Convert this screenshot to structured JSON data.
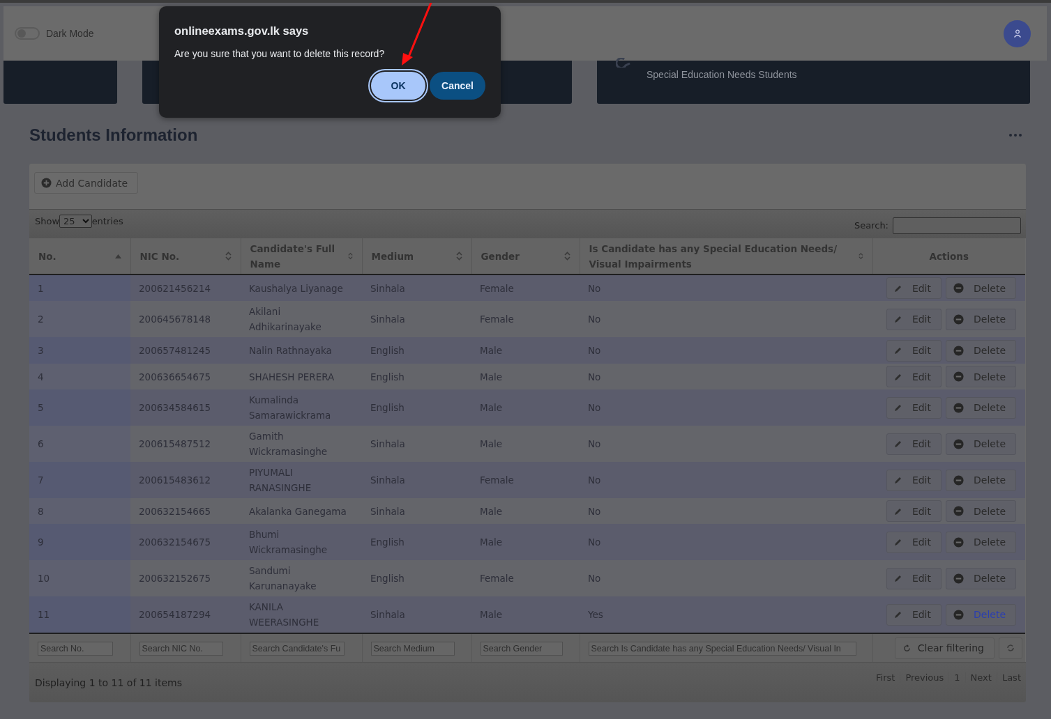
{
  "header": {
    "dark_mode": {
      "label": "Dark Mode",
      "on": false
    }
  },
  "stat_cards": [
    {
      "kind": "blank"
    },
    {
      "kind": "blank"
    },
    {
      "kind": "labeled",
      "label": "Special Education Needs Students"
    }
  ],
  "page_title": "Students Information",
  "add_button": {
    "label": "Add Candidate"
  },
  "length_menu": {
    "show": "Show",
    "value": "25",
    "entries": "entries"
  },
  "search": {
    "label": "Search:"
  },
  "table": {
    "columns": [
      {
        "label": "No.",
        "sortable": true,
        "sorted": true
      },
      {
        "label": "NIC No.",
        "sortable": true,
        "sorted": false
      },
      {
        "label": "Candidate's Full Name",
        "sortable": true,
        "sorted": false
      },
      {
        "label": "Medium",
        "sortable": true,
        "sorted": false
      },
      {
        "label": "Gender",
        "sortable": true,
        "sorted": false
      },
      {
        "label": "Is Candidate has any Special Education Needs/ Visual Impairments",
        "sortable": true,
        "sorted": false
      },
      {
        "label": "Actions",
        "sortable": false,
        "sorted": false
      }
    ],
    "rows": [
      {
        "cells": [
          "1",
          "200621456214",
          "Kaushalya Liyanage",
          "Sinhala",
          "Female",
          "No"
        ],
        "edit": "Edit",
        "delete": "Delete",
        "delete_hovered": false
      },
      {
        "cells": [
          "2",
          "200645678148",
          "Akilani Adhikarinayake",
          "Sinhala",
          "Female",
          "No"
        ],
        "edit": "Edit",
        "delete": "Delete",
        "delete_hovered": false
      },
      {
        "cells": [
          "3",
          "200657481245",
          "Nalin Rathnayaka",
          "English",
          "Male",
          "No"
        ],
        "edit": "Edit",
        "delete": "Delete",
        "delete_hovered": false
      },
      {
        "cells": [
          "4",
          "200636654675",
          "SHAHESH PERERA",
          "English",
          "Male",
          "No"
        ],
        "edit": "Edit",
        "delete": "Delete",
        "delete_hovered": false
      },
      {
        "cells": [
          "5",
          "200634584615",
          "Kumalinda Samarawickrama",
          "English",
          "Male",
          "No"
        ],
        "edit": "Edit",
        "delete": "Delete",
        "delete_hovered": false
      },
      {
        "cells": [
          "6",
          "200615487512",
          "Gamith Wickramasinghe",
          "Sinhala",
          "Male",
          "No"
        ],
        "edit": "Edit",
        "delete": "Delete",
        "delete_hovered": false
      },
      {
        "cells": [
          "7",
          "200615483612",
          "PIYUMALI RANASINGHE",
          "Sinhala",
          "Female",
          "No"
        ],
        "edit": "Edit",
        "delete": "Delete",
        "delete_hovered": false
      },
      {
        "cells": [
          "8",
          "200632154665",
          "Akalanka Ganegama",
          "Sinhala",
          "Male",
          "No"
        ],
        "edit": "Edit",
        "delete": "Delete",
        "delete_hovered": false
      },
      {
        "cells": [
          "9",
          "200632154675",
          "Bhumi Wickramasinghe",
          "English",
          "Male",
          "No"
        ],
        "edit": "Edit",
        "delete": "Delete",
        "delete_hovered": false
      },
      {
        "cells": [
          "10",
          "200632152675",
          "Sandumi Karunanayake",
          "English",
          "Female",
          "No"
        ],
        "edit": "Edit",
        "delete": "Delete",
        "delete_hovered": false
      },
      {
        "cells": [
          "11",
          "200654187294",
          "KANILA WEERASINGHE",
          "Sinhala",
          "Male",
          "Yes"
        ],
        "edit": "Edit",
        "delete": "Delete",
        "delete_hovered": true
      }
    ],
    "filters": [
      {
        "placeholder": "Search No."
      },
      {
        "placeholder": "Search NIC No."
      },
      {
        "placeholder": "Search Candidate's Fu"
      },
      {
        "placeholder": "Search Medium"
      },
      {
        "placeholder": "Search Gender"
      },
      {
        "placeholder": "Search Is Candidate has any Special Education Needs/ Visual In"
      }
    ],
    "clear_button": "Clear filtering"
  },
  "footer": {
    "info": "Displaying 1 to 11 of 11 items",
    "pager": [
      "First",
      "Previous",
      "1",
      "Next",
      "Last"
    ]
  },
  "dialog": {
    "title": "onlineexams.gov.lk says",
    "message": "Are you sure that you want to delete this record?",
    "buttons": [
      {
        "label": "OK",
        "selected": true
      },
      {
        "label": "Cancel",
        "selected": false
      }
    ]
  }
}
